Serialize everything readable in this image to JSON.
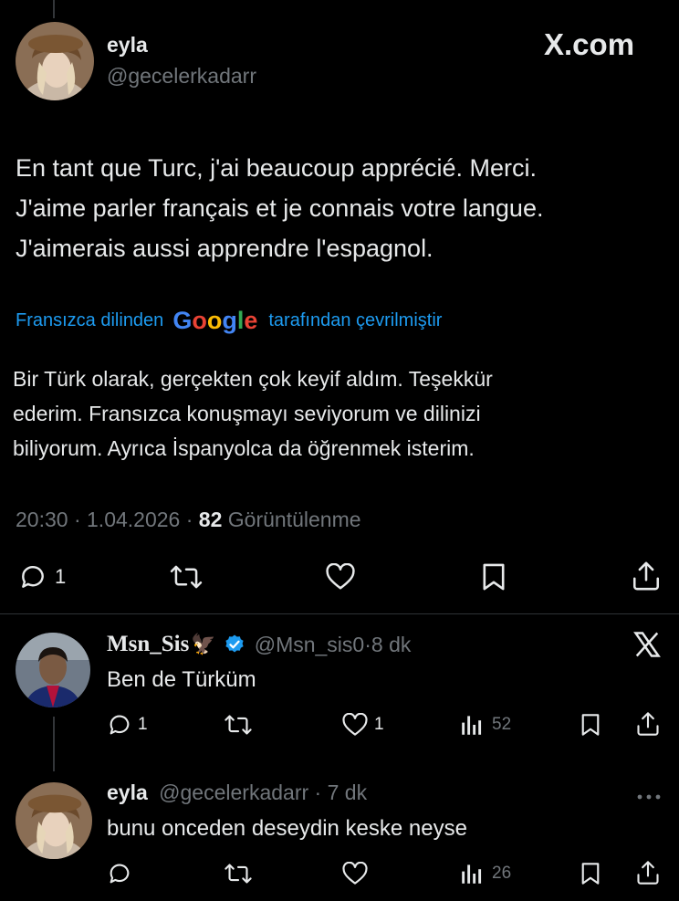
{
  "main_tweet": {
    "display_name": "eyla",
    "handle": "@gecelerkadarr",
    "brand": "X.com",
    "text_lines": [
      "En tant que Turc, j'ai beaucoup apprécié. Merci.",
      "J'aime parler français et je connais votre langue.",
      "J'aimerais aussi apprendre l'espagnol."
    ],
    "translate_prefix": "Fransızca dilinden",
    "translate_brand": "Google",
    "translate_suffix": "tarafından çevrilmiştir",
    "translated_lines": [
      "Bir Türk olarak, gerçekten çok keyif aldım. Teşekkür",
      "ederim. Fransızca konuşmayı seviyorum ve dilinizi",
      "biliyorum. Ayrıca İspanyolca da öğrenmek isterim."
    ],
    "time": "20:30",
    "date": "1.04.2026",
    "views_count": "82",
    "views_label": "Görüntülenme",
    "reply_count": "1"
  },
  "replies": [
    {
      "display_name": "Msn_Sis",
      "emoji": "🦅",
      "handle": "@Msn_sis0",
      "age": "8 dk",
      "text": "Ben de Türküm",
      "reply_count": "1",
      "like_count": "1",
      "views_count": "52"
    },
    {
      "display_name": "eyla",
      "handle": "@gecelerkadarr",
      "age": "7 dk",
      "text": "bunu onceden deseydin keske neyse",
      "views_count": "26"
    }
  ],
  "colors": {
    "background": "#000000",
    "text": "#e7e9ea",
    "secondary": "#71767b",
    "link": "#1d9bf0",
    "verified": "#1d9bf0"
  }
}
